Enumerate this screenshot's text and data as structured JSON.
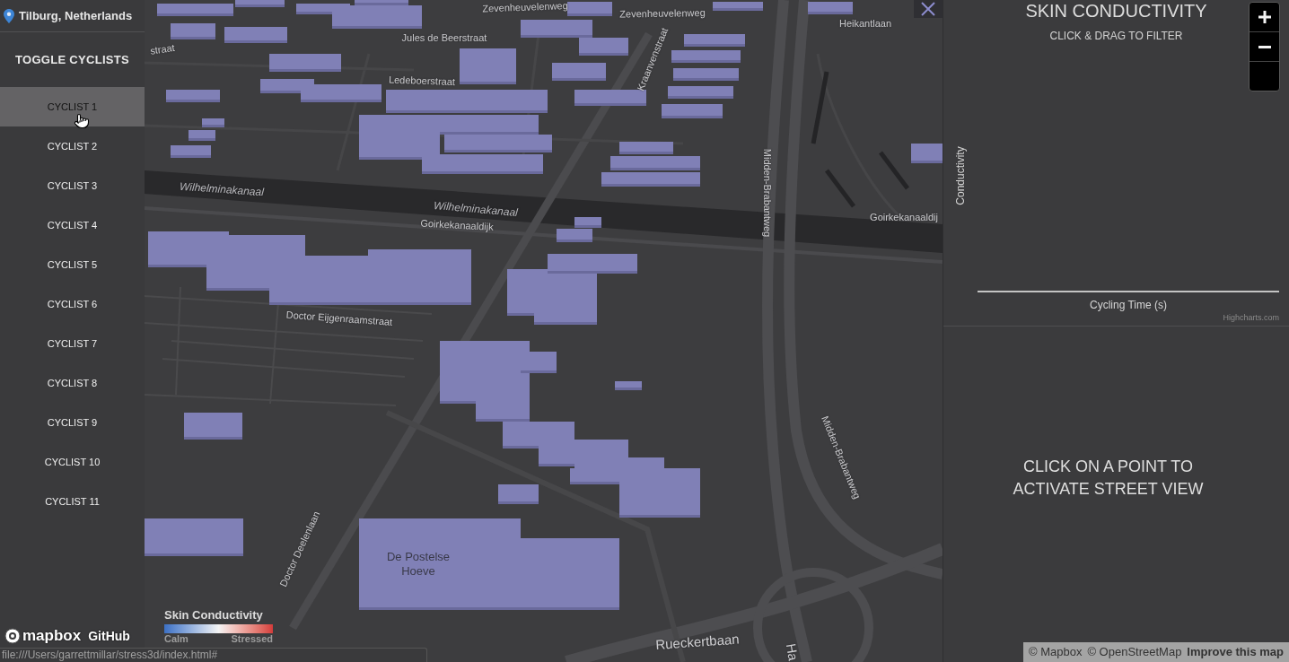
{
  "location": {
    "label": "Tilburg, Netherlands"
  },
  "sidebar": {
    "heading": "TOGGLE CYCLISTS",
    "items": [
      {
        "label": "CYCLIST 1",
        "selected": true
      },
      {
        "label": "CYCLIST 2",
        "selected": false
      },
      {
        "label": "CYCLIST 3",
        "selected": false
      },
      {
        "label": "CYCLIST 4",
        "selected": false
      },
      {
        "label": "CYCLIST 5",
        "selected": false
      },
      {
        "label": "CYCLIST 6",
        "selected": false
      },
      {
        "label": "CYCLIST 7",
        "selected": false
      },
      {
        "label": "CYCLIST 8",
        "selected": false
      },
      {
        "label": "CYCLIST 9",
        "selected": false
      },
      {
        "label": "CYCLIST 10",
        "selected": false
      },
      {
        "label": "CYCLIST 11",
        "selected": false
      }
    ]
  },
  "map": {
    "labels": [
      {
        "text": "straat",
        "kind": "street"
      },
      {
        "text": "Zevenheuvelenweg",
        "kind": "street"
      },
      {
        "text": "Zevenheuvelenweg",
        "kind": "street"
      },
      {
        "text": "Heikantlaan",
        "kind": "street"
      },
      {
        "text": "Jules de Beerstraat",
        "kind": "street"
      },
      {
        "text": "Ledeboerstraat",
        "kind": "street"
      },
      {
        "text": "Kraanvenstraat",
        "kind": "street"
      },
      {
        "text": "Wilhelminakanaal",
        "kind": "water"
      },
      {
        "text": "Wilhelminakanaal",
        "kind": "water"
      },
      {
        "text": "Goirkekanaaldijk",
        "kind": "street"
      },
      {
        "text": "Midden-Brabantweg",
        "kind": "street"
      },
      {
        "text": "Goirkekanaaldij",
        "kind": "street"
      },
      {
        "text": "Doctor Eijgenraamstraat",
        "kind": "street"
      },
      {
        "text": "Midden-Brabantweg",
        "kind": "street"
      },
      {
        "text": "Doctor Deelenlaan",
        "kind": "street"
      },
      {
        "text": "De Postelse Hoeve",
        "kind": "place"
      },
      {
        "text": "Rueckertbaan",
        "kind": "road"
      },
      {
        "text": "Ha",
        "kind": "road"
      }
    ],
    "legend": {
      "title": "Skin Conductivity",
      "low": "Calm",
      "high": "Stressed"
    },
    "logo": "mapbox",
    "link": "GitHub"
  },
  "chart_panel": {
    "title": "SKIN CONDUCTIVITY",
    "subtitle": "CLICK & DRAG TO FILTER",
    "y_axis_title": "Conductivity",
    "x_axis_title": "Cycling Time (s)",
    "credits": "Highcharts.com"
  },
  "street_view": {
    "message": "CLICK ON A POINT TO ACTIVATE STREET VIEW"
  },
  "attribution": [
    {
      "text": "© Mapbox",
      "kind": "plain"
    },
    {
      "text": "© OpenStreetMap",
      "kind": "plain"
    },
    {
      "text": "Improve this map",
      "kind": "bold"
    }
  ],
  "status_bar": {
    "url": "file:///Users/garrettmillar/stress3d/index.html#"
  }
}
